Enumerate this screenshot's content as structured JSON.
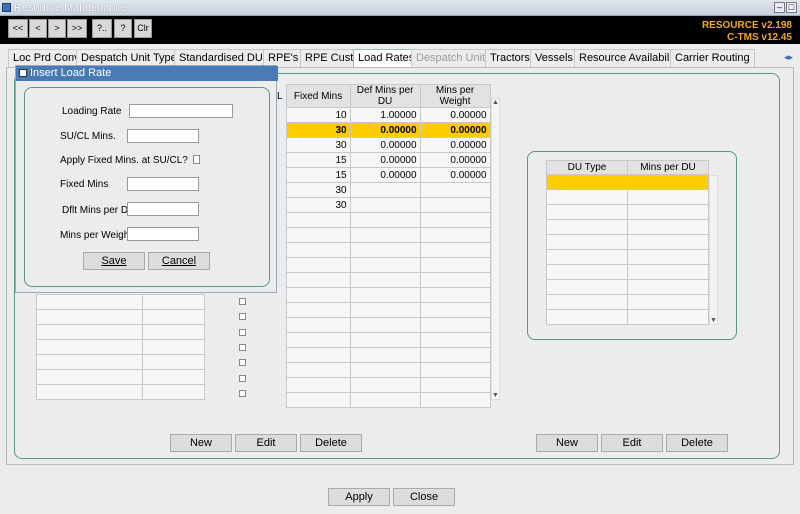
{
  "window": {
    "title": "Resource Maintenance"
  },
  "toolbar": {
    "buttons": [
      "<<",
      "<",
      ">",
      ">>",
      "?..",
      "?",
      "Clr"
    ],
    "version": "RESOURCE v2.198",
    "ctms": "C-TMS v12.45"
  },
  "tabs": [
    {
      "label": "Loc Prd Conv"
    },
    {
      "label": "Despatch Unit Types"
    },
    {
      "label": "Standardised DU's"
    },
    {
      "label": "RPE's"
    },
    {
      "label": "RPE Cust"
    },
    {
      "label": "Load Rates"
    },
    {
      "label": "Despatch Units"
    },
    {
      "label": "Tractors"
    },
    {
      "label": "Vessels"
    },
    {
      "label": "Resource Availability"
    },
    {
      "label": "Carrier Routing"
    }
  ],
  "load_grid": {
    "col_l": "L",
    "headers": [
      "Fixed Mins",
      "Def Mins per DU",
      "Mins per Weight"
    ],
    "rows": [
      [
        "10",
        "1.00000",
        "0.00000"
      ],
      [
        "30",
        "0.00000",
        "0.00000"
      ],
      [
        "30",
        "0.00000",
        "0.00000"
      ],
      [
        "15",
        "0.00000",
        "0.00000"
      ],
      [
        "15",
        "0.00000",
        "0.00000"
      ],
      [
        "30",
        "",
        ""
      ],
      [
        "30",
        "",
        ""
      ]
    ]
  },
  "du_grid": {
    "headers": [
      "DU Type",
      "Mins per DU"
    ]
  },
  "left_buttons": {
    "new": "New",
    "edit": "Edit",
    "delete": "Delete"
  },
  "right_buttons": {
    "new": "New",
    "edit": "Edit",
    "delete": "Delete"
  },
  "bottom": {
    "apply": "Apply",
    "close": "Close"
  },
  "dialog": {
    "title": "Insert Load Rate",
    "loading_rate": "Loading Rate",
    "sucl_mins": "SU/CL Mins.",
    "apply_fixed": "Apply Fixed Mins. at SU/CL?",
    "fixed_mins": "Fixed Mins",
    "dflt_mins": "Dflt Mins per Du",
    "mins_weight": "Mins per Weight",
    "save": "Save",
    "cancel": "Cancel"
  }
}
